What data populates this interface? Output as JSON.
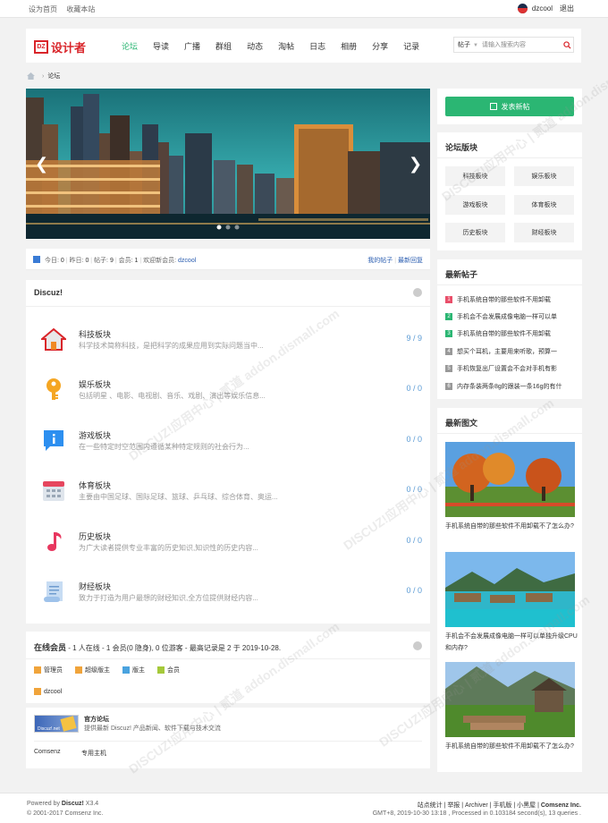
{
  "topbar": {
    "set_home": "设为首页",
    "bookmark": "收藏本站",
    "username": "dzcool",
    "logout": "退出"
  },
  "header": {
    "logo_mark": "DZ",
    "logo_name": "设计者",
    "nav": [
      "论坛",
      "导读",
      "广播",
      "群组",
      "动态",
      "淘帖",
      "日志",
      "相册",
      "分享",
      "记录"
    ],
    "search_type": "帖子",
    "search_placeholder": "请输入搜索内容"
  },
  "breadcrumb": {
    "current": "论坛"
  },
  "stats": {
    "today_label": "今日:",
    "today": "0",
    "yesterday_label": "昨日:",
    "yesterday": "0",
    "posts_label": "帖子:",
    "posts": "9",
    "members_label": "会员:",
    "members": "1",
    "welcome_label": "欢迎新会员:",
    "newest_member": "dzcool",
    "my_posts": "我的帖子",
    "latest_replies": "最新回复"
  },
  "forum": {
    "title": "Discuz!",
    "boards": [
      {
        "name": "科技板块",
        "desc": "科学技术简称科技，是把科学的成果应用到实际问题当中...",
        "count": "9 / 9"
      },
      {
        "name": "娱乐板块",
        "desc": "包括明星 、电影、电视剧、音乐、戏剧、演出等娱乐信息...",
        "count": "0 / 0"
      },
      {
        "name": "游戏板块",
        "desc": "在一些特定时空范围内遵循某种特定规则的社会行为...",
        "count": "0 / 0"
      },
      {
        "name": "体育板块",
        "desc": "主要由中国足球、国际足球、篮球、乒乓球、综合体育、奥运...",
        "count": "0 / 0"
      },
      {
        "name": "历史板块",
        "desc": "为广大读者提供专业丰富的历史知识,知识性的历史内容...",
        "count": "0 / 0"
      },
      {
        "name": "财经板块",
        "desc": "致力于打造为用户最想的财经知识,全方位提供财经内容...",
        "count": "0 / 0"
      }
    ]
  },
  "online": {
    "title": "在线会员",
    "summary": "- 1 人在线 - 1 会员(0 隐身), 0 位游客 - 最高记录是 2 于 2019-10-28.",
    "legend": [
      {
        "label": "管理员",
        "color": "#f0a43b"
      },
      {
        "label": "超级版主",
        "color": "#f0a43b"
      },
      {
        "label": "版主",
        "color": "#4aa3df"
      },
      {
        "label": "会员",
        "color": "#a5c93a"
      }
    ],
    "user": "dzcool"
  },
  "links": {
    "banner_text": "Discuz!.net",
    "name": "官方论坛",
    "desc": "提供最新 Discuz! 产品新闻、软件下载与技术交流",
    "text_links": [
      "Comsenz",
      "专用主机"
    ]
  },
  "sidebar": {
    "post_button": "发表新帖",
    "boards_title": "论坛版块",
    "boards": [
      "科技板块",
      "娱乐板块",
      "游戏板块",
      "体育板块",
      "历史板块",
      "财经板块"
    ],
    "newposts_title": "最新帖子",
    "newposts": [
      {
        "num": "1",
        "color": "#e94f6a",
        "title": "手机系统自带的那些软件不用卸载"
      },
      {
        "num": "2",
        "color": "#2bb673",
        "title": "手机会不会发展成像电脑一样可以单"
      },
      {
        "num": "3",
        "color": "#2bb673",
        "title": "手机系统自带的那些软件不用卸载"
      },
      {
        "num": "4",
        "color": "#999999",
        "title": "想买个耳机，主要用来听歌，预算一"
      },
      {
        "num": "5",
        "color": "#999999",
        "title": "手机恢复出厂设置会不会对手机有影"
      },
      {
        "num": "6",
        "color": "#999999",
        "title": "内存条装两条8g的跟装一条16g的有什"
      }
    ],
    "newpics_title": "最新图文",
    "newpics": [
      {
        "caption": "手机系统自带的那些软件不用卸载不了怎么办?"
      },
      {
        "caption": "手机会不会发展成像电脑一样可以单独升级CPU和内存?"
      },
      {
        "caption": "手机系统自带的那些软件不用卸载不了怎么办?"
      }
    ]
  },
  "footer": {
    "powered": "Powered by",
    "product": "Discuz!",
    "version": "X3.4",
    "copyright": "© 2001-2017 Comsenz Inc.",
    "links": [
      "站点统计",
      "举报",
      "Archiver",
      "手机版",
      "小黑屋"
    ],
    "company": "Comsenz Inc.",
    "runtime": "GMT+8, 2019-10-30 13:18 , Processed in 0.103184 second(s), 13 queries ."
  },
  "watermark": "DISCUZ!应用中心 | 贰道 addon.dismall.com",
  "colors": {
    "accent": "#2bb673",
    "brand": "#d9252a",
    "link": "#2a5db0"
  }
}
